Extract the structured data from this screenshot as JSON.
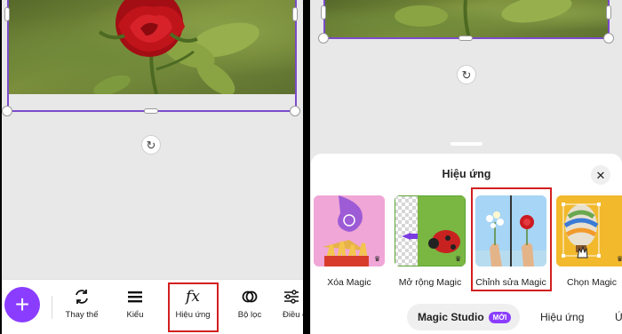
{
  "left_screen": {
    "add_button": {
      "icon": "plus-icon",
      "label": "+"
    },
    "rotate_icon": "rotate-icon",
    "toolbar": [
      {
        "id": "replace",
        "icon": "replace-icon",
        "label": "Thay thế"
      },
      {
        "id": "style",
        "icon": "style-icon",
        "label": "Kiểu"
      },
      {
        "id": "effects",
        "icon": "fx-icon",
        "glyph": "fx",
        "label": "Hiệu ứng",
        "highlighted": true
      },
      {
        "id": "filter",
        "icon": "filter-icon",
        "label": "Bộ lọc"
      },
      {
        "id": "adjust",
        "icon": "adjust-icon",
        "label": "Điều c"
      }
    ]
  },
  "right_screen": {
    "sheet_title": "Hiệu ứng",
    "close_icon": "close-icon",
    "effects": [
      {
        "id": "magic-eraser",
        "label": "Xóa Magic",
        "premium": true
      },
      {
        "id": "magic-expand",
        "label": "Mở rộng Magic",
        "premium": true
      },
      {
        "id": "magic-edit",
        "label": "Chỉnh sửa Magic",
        "premium": false,
        "highlighted": true
      },
      {
        "id": "magic-grab",
        "label": "Chọn Magic",
        "premium": true
      }
    ],
    "tabs": [
      {
        "label": "Magic Studio",
        "badge": "MỚI",
        "active": true
      },
      {
        "label": "Hiệu ứng",
        "active": false
      },
      {
        "label": "Ứ",
        "active": false
      }
    ]
  },
  "colors": {
    "accent": "#8b3dff",
    "selection": "#7b4ccc",
    "highlight_box": "#d21f1f",
    "canvas_bg": "#e8e8e8"
  }
}
